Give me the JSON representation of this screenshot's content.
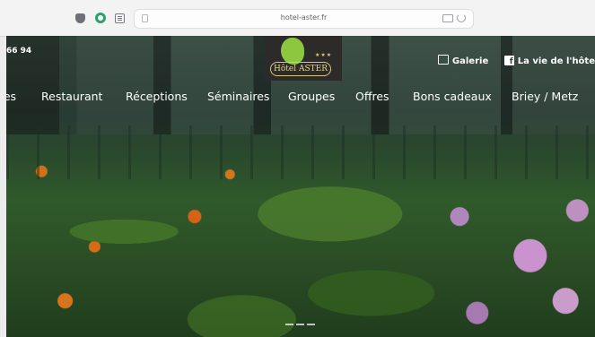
{
  "browser": {
    "url": "hotel-aster.fr"
  },
  "site": {
    "phone": "66 94",
    "logo": {
      "stars": "★★★",
      "name": "Hôtel ASTER"
    },
    "top_links": [
      {
        "label": "Galerie"
      },
      {
        "label": "La vie de l'hôte"
      }
    ],
    "nav": [
      "res",
      "Restaurant",
      "Réceptions",
      "Séminaires",
      "Groupes",
      "Offres",
      "Bons cadeaux",
      "Briey / Metz"
    ]
  },
  "colors": {
    "accent_gold": "#d8c780",
    "logo_leaf": "#8dc63f"
  }
}
